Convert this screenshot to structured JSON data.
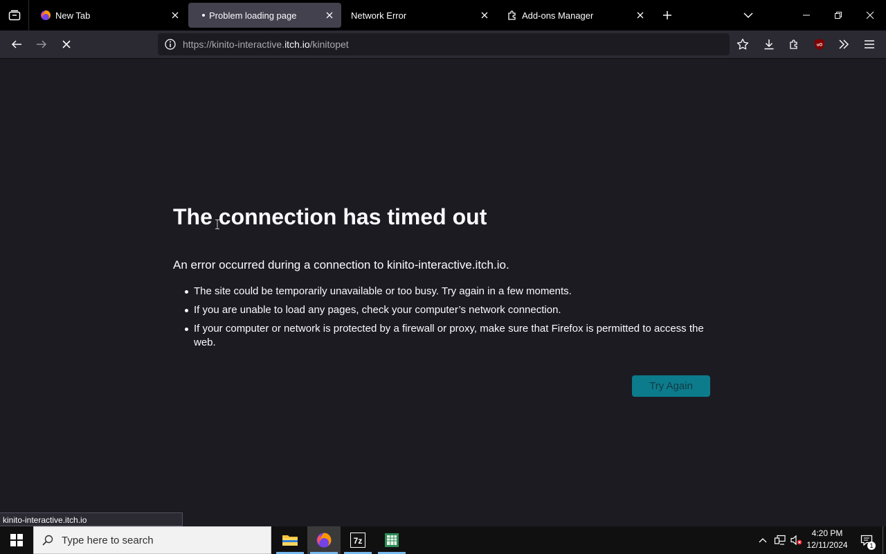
{
  "tabs": [
    {
      "title": "New Tab",
      "favicon": "firefox-icon"
    },
    {
      "title": "Problem loading page",
      "favicon": "loading-dot",
      "active": true
    },
    {
      "title": "Network Error",
      "favicon": "none"
    },
    {
      "title": "Add-ons Manager",
      "favicon": "puzzle-icon"
    }
  ],
  "urlbar": {
    "prefix": "https://kinito-interactive.",
    "domain": "itch.io",
    "path": "/kinitopet"
  },
  "error": {
    "title": "The connection has timed out",
    "intro": "An error occurred during a connection to kinito-interactive.itch.io.",
    "items": [
      "The site could be temporarily unavailable or too busy. Try again in a few moments.",
      "If you are unable to load any pages, check your computer’s network connection.",
      "If your computer or network is protected by a firewall or proxy, make sure that Firefox is permitted to access the web."
    ],
    "button": "Try Again"
  },
  "status_text": "kinito-interactive.itch.io",
  "taskbar": {
    "search_placeholder": "Type here to search",
    "time": "4:20 PM",
    "date": "12/11/2024",
    "notification_count": "1",
    "ublock_label": "uO"
  },
  "colors": {
    "tabstrip_bg": "#000000",
    "toolbar_bg": "#2b2a33",
    "content_bg": "#1c1b22",
    "accent_button": "#0c7b8c",
    "taskbar_bg": "#101010"
  }
}
